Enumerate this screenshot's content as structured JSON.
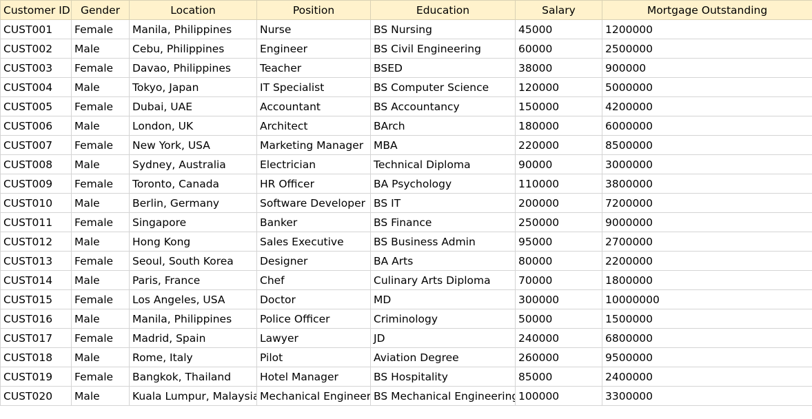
{
  "columns": [
    "Customer ID",
    "Gender",
    "Location",
    "Position",
    "Education",
    "Salary",
    "Mortgage Outstanding"
  ],
  "rows": [
    [
      "CUST001",
      "Female",
      "Manila, Philippines",
      "Nurse",
      "BS Nursing",
      "45000",
      "1200000"
    ],
    [
      "CUST002",
      "Male",
      "Cebu, Philippines",
      "Engineer",
      "BS Civil Engineering",
      "60000",
      "2500000"
    ],
    [
      "CUST003",
      "Female",
      "Davao, Philippines",
      "Teacher",
      "BSED",
      "38000",
      "900000"
    ],
    [
      "CUST004",
      "Male",
      "Tokyo, Japan",
      "IT Specialist",
      "BS Computer Science",
      "120000",
      "5000000"
    ],
    [
      "CUST005",
      "Female",
      "Dubai, UAE",
      "Accountant",
      "BS Accountancy",
      "150000",
      "4200000"
    ],
    [
      "CUST006",
      "Male",
      "London, UK",
      "Architect",
      "BArch",
      "180000",
      "6000000"
    ],
    [
      "CUST007",
      "Female",
      "New York, USA",
      "Marketing Manager",
      "MBA",
      "220000",
      "8500000"
    ],
    [
      "CUST008",
      "Male",
      "Sydney, Australia",
      "Electrician",
      "Technical Diploma",
      "90000",
      "3000000"
    ],
    [
      "CUST009",
      "Female",
      "Toronto, Canada",
      "HR Officer",
      "BA Psychology",
      "110000",
      "3800000"
    ],
    [
      "CUST010",
      "Male",
      "Berlin, Germany",
      "Software Developer",
      "BS IT",
      "200000",
      "7200000"
    ],
    [
      "CUST011",
      "Female",
      "Singapore",
      "Banker",
      "BS Finance",
      "250000",
      "9000000"
    ],
    [
      "CUST012",
      "Male",
      "Hong Kong",
      "Sales Executive",
      "BS Business Admin",
      "95000",
      "2700000"
    ],
    [
      "CUST013",
      "Female",
      "Seoul, South Korea",
      "Designer",
      "BA Arts",
      "80000",
      "2200000"
    ],
    [
      "CUST014",
      "Male",
      "Paris, France",
      "Chef",
      "Culinary Arts Diploma",
      "70000",
      "1800000"
    ],
    [
      "CUST015",
      "Female",
      "Los Angeles, USA",
      "Doctor",
      "MD",
      "300000",
      "10000000"
    ],
    [
      "CUST016",
      "Male",
      "Manila, Philippines",
      "Police Officer",
      "Criminology",
      "50000",
      "1500000"
    ],
    [
      "CUST017",
      "Female",
      "Madrid, Spain",
      "Lawyer",
      "JD",
      "240000",
      "6800000"
    ],
    [
      "CUST018",
      "Male",
      "Rome, Italy",
      "Pilot",
      "Aviation Degree",
      "260000",
      "9500000"
    ],
    [
      "CUST019",
      "Female",
      "Bangkok, Thailand",
      "Hotel Manager",
      "BS Hospitality",
      "85000",
      "2400000"
    ],
    [
      "CUST020",
      "Male",
      "Kuala Lumpur, Malaysia",
      "Mechanical Engineer",
      "BS Mechanical Engineering",
      "100000",
      "3300000"
    ]
  ]
}
